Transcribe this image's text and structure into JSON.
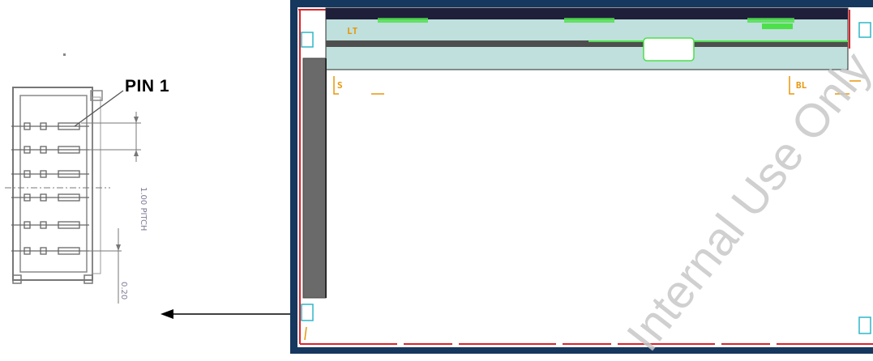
{
  "labels": {
    "pin1": "PIN 1",
    "pitch": "1.00 PITCH",
    "dim": "0.20",
    "watermark": "Internal Use Only"
  },
  "pcb_tags": {
    "top_left": "LT",
    "side_left": "S",
    "side_right": "BL"
  },
  "colors": {
    "pcb_border": "#16375e",
    "board_edge_red": "#d9242b",
    "panel_fill": "#bfe0dc",
    "panel_header": "#1f1f3a",
    "highlight_green": "#4ee04a",
    "connector_gray": "#6a6a6a",
    "silkscreen_orange": "#e8960a",
    "pad_cyan": "#2fb7c8"
  }
}
